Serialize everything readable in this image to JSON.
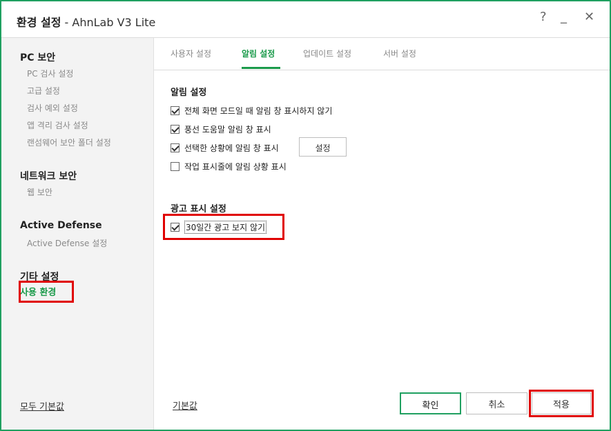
{
  "window": {
    "title_bold": "환경 설정",
    "title_sub": "- AhnLab V3 Lite",
    "help": "?",
    "minimize": "_",
    "close": "✕"
  },
  "sidebar": {
    "sections": [
      {
        "title": "PC 보안",
        "items": [
          "PC 검사 설정",
          "고급 설정",
          "검사 예외 설정",
          "앱 격리 검사 설정",
          "랜섬웨어 보안 폴더 설정"
        ]
      },
      {
        "title": "네트워크 보안",
        "items": [
          "웹 보안"
        ]
      },
      {
        "title": "Active Defense",
        "items": [
          "Active Defense 설정"
        ]
      },
      {
        "title": "기타 설정",
        "items": [
          "사용 환경"
        ]
      }
    ],
    "reset_all": "모두 기본값"
  },
  "tabs": [
    "사용자 설정",
    "알림 설정",
    "업데이트 설정",
    "서버 설정"
  ],
  "active_tab": "알림 설정",
  "notification": {
    "title": "알림 설정",
    "options": [
      {
        "label": "전체 화면 모드일 때 알림 창 표시하지 않기",
        "checked": true
      },
      {
        "label": "풍선 도움말 알림 창 표시",
        "checked": true
      },
      {
        "label": "선택한 상황에 알림 창 표시",
        "checked": true
      },
      {
        "label": "작업 표시줄에 알림 상황 표시",
        "checked": false
      }
    ],
    "settings_button": "설정"
  },
  "ads": {
    "title": "광고 표시 설정",
    "option": {
      "label": "30일간 광고 보지 않기",
      "checked": true
    }
  },
  "footer": {
    "default": "기본값",
    "ok": "확인",
    "cancel": "취소",
    "apply": "적용"
  },
  "colors": {
    "accent": "#1fa060",
    "highlight": "#e00000"
  }
}
